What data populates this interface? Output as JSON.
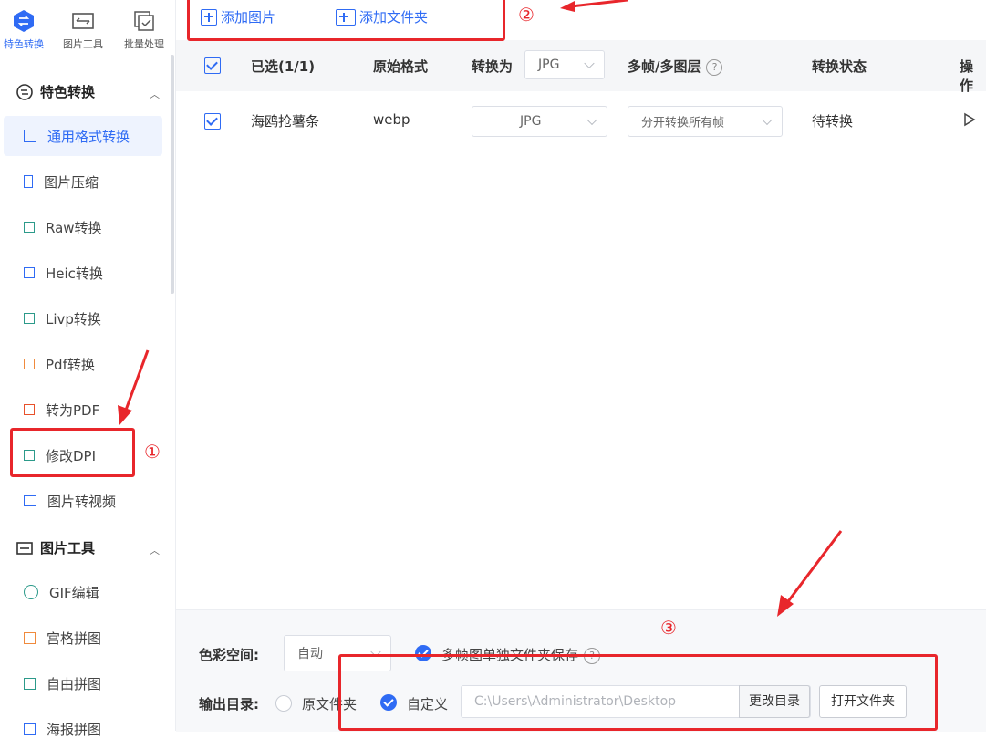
{
  "topnav": [
    {
      "label": "特色转换",
      "icon": "convert-icon",
      "active": true
    },
    {
      "label": "图片工具",
      "icon": "image-tool-icon",
      "active": false
    },
    {
      "label": "批量处理",
      "icon": "batch-icon",
      "active": false
    }
  ],
  "sidebar": {
    "group1": {
      "label": "特色转换",
      "icon": "convert-icon"
    },
    "items1": [
      {
        "label": "通用格式转换",
        "active": true
      },
      {
        "label": "图片压缩"
      },
      {
        "label": "Raw转换"
      },
      {
        "label": "Heic转换"
      },
      {
        "label": "Livp转换"
      },
      {
        "label": "Pdf转换"
      },
      {
        "label": "转为PDF"
      },
      {
        "label": "修改DPI"
      },
      {
        "label": "图片转视频"
      }
    ],
    "group2": {
      "label": "图片工具",
      "icon": "image-tool-icon"
    },
    "items2": [
      {
        "label": "GIF编辑"
      },
      {
        "label": "宫格拼图"
      },
      {
        "label": "自由拼图"
      },
      {
        "label": "海报拼图"
      }
    ]
  },
  "toolbar": {
    "add_image": "添加图片",
    "add_folder": "添加文件夹"
  },
  "table": {
    "headers": {
      "selected": "已选(1/1)",
      "original_format": "原始格式",
      "convert_to": "转换为",
      "convert_to_value": "JPG",
      "multiframe": "多帧/多图层",
      "status": "转换状态",
      "action": "操作"
    },
    "rows": [
      {
        "name": "海鸥抢薯条",
        "format": "webp",
        "target": "JPG",
        "multiframe": "分开转换所有帧",
        "status": "待转换",
        "action_icon": "play-icon"
      }
    ]
  },
  "bottom": {
    "color_space_label": "色彩空间:",
    "color_space_value": "自动",
    "multiframe_save_label": "多帧图单独文件夹保存",
    "output_label": "输出目录:",
    "option_original": "原文件夹",
    "option_custom": "自定义",
    "path": "C:\\Users\\Administrator\\Desktop",
    "change_dir": "更改目录",
    "open_folder": "打开文件夹"
  },
  "annotations": {
    "n1": "①",
    "n2": "②",
    "n3": "③",
    "color": "#e8262b"
  },
  "accent": "#2f6bf4"
}
